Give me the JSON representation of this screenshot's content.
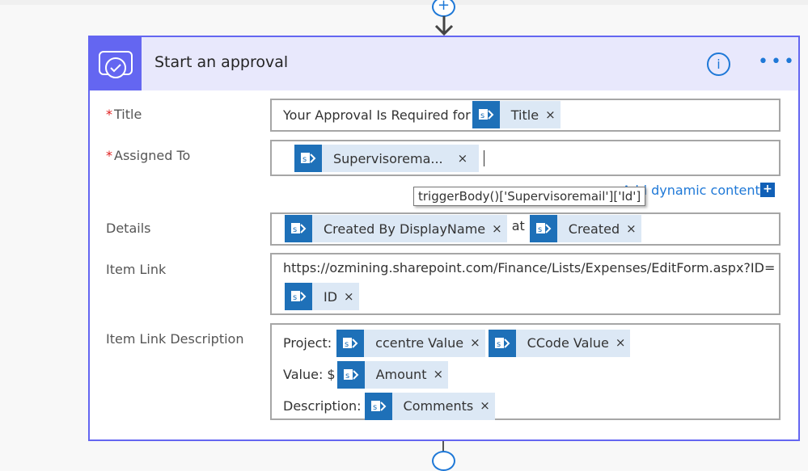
{
  "action": {
    "title": "Start an approval",
    "icon": "approval-icon",
    "info_icon": "info-icon",
    "more_icon": "more-icon",
    "accent": "#6466f1"
  },
  "fields": {
    "title": {
      "label": "Title",
      "required": "*",
      "prefix": "Your Approval Is Required for",
      "tokens": [
        "Title"
      ]
    },
    "assigned": {
      "label": "Assigned To",
      "required": "*",
      "tokens": [
        "Supervisorema..."
      ]
    },
    "details": {
      "label": "Details",
      "tokens": [
        "Created By DisplayName",
        "Created"
      ],
      "sep": "at"
    },
    "item_link": {
      "label": "Item Link",
      "url": "https://ozmining.sharepoint.com/Finance/Lists/Expenses/EditForm.aspx?ID=",
      "tokens": [
        "ID"
      ]
    },
    "item_link_desc": {
      "label": "Item Link Description",
      "project_label": "Project:",
      "value_label": "Value: $",
      "description_label": "Description:",
      "tokens": [
        "ccentre Value",
        "CCode Value",
        "Amount",
        "Comments"
      ]
    }
  },
  "add_dynamic": {
    "label": "Add dynamic content",
    "plus": "+"
  },
  "tooltip": "triggerBody()['Supervisoremail']['Id']",
  "remove": "×",
  "add_step": "+"
}
